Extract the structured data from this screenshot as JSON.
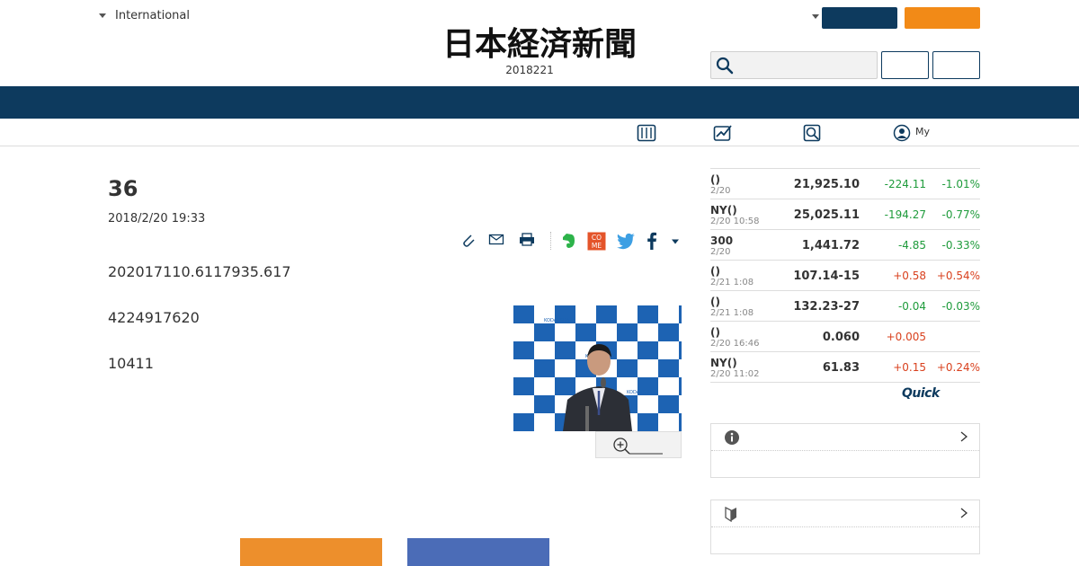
{
  "header": {
    "edition_label": "International",
    "issue_date": "2018221",
    "logo_alt": "日本経済新聞",
    "colors": {
      "navy": "#0d3a5e",
      "orange": "#f28a17"
    }
  },
  "subnav": {
    "items": [
      {
        "icon": "newspaper-icon"
      },
      {
        "icon": "chart-icon"
      },
      {
        "icon": "search-doc-icon"
      },
      {
        "icon": "user-icon",
        "label": "My"
      }
    ]
  },
  "article": {
    "title": "36",
    "date": "2018/2/20 19:33",
    "paragraphs": [
      "202017110.6117935.617",
      "4224917620",
      "10411"
    ],
    "photo_sign": "KODANSHA",
    "share_icons": [
      "clip-icon",
      "mail-icon",
      "print-icon",
      "evernote-icon",
      "come-icon",
      "twitter-icon",
      "facebook-icon",
      "caret-icon"
    ]
  },
  "market": {
    "rows": [
      {
        "name": "()",
        "time": "2/20",
        "value": "21,925.10",
        "change": "-224.11",
        "pct": "-1.01%",
        "dir": "neg"
      },
      {
        "name": "NY()",
        "time": "2/20 10:58",
        "value": "25,025.11",
        "change": "-194.27",
        "pct": "-0.77%",
        "dir": "neg"
      },
      {
        "name": "300",
        "time": "2/20",
        "value": "1,441.72",
        "change": "-4.85",
        "pct": "-0.33%",
        "dir": "neg"
      },
      {
        "name": "()",
        "time": "2/21 1:08",
        "value": "107.14-15",
        "change": "+0.58",
        "pct": "+0.54%",
        "dir": "pos"
      },
      {
        "name": "()",
        "time": "2/21 1:08",
        "value": "132.23-27",
        "change": "-0.04",
        "pct": "-0.03%",
        "dir": "neg"
      },
      {
        "name": "()",
        "time": "2/20 16:46",
        "value": "0.060",
        "change": "+0.005",
        "pct": "",
        "dir": "pos"
      },
      {
        "name": "NY()",
        "time": "2/20 11:02",
        "value": "61.83",
        "change": "+0.15",
        "pct": "+0.24%",
        "dir": "pos"
      }
    ],
    "quick_logo": "Quick"
  }
}
